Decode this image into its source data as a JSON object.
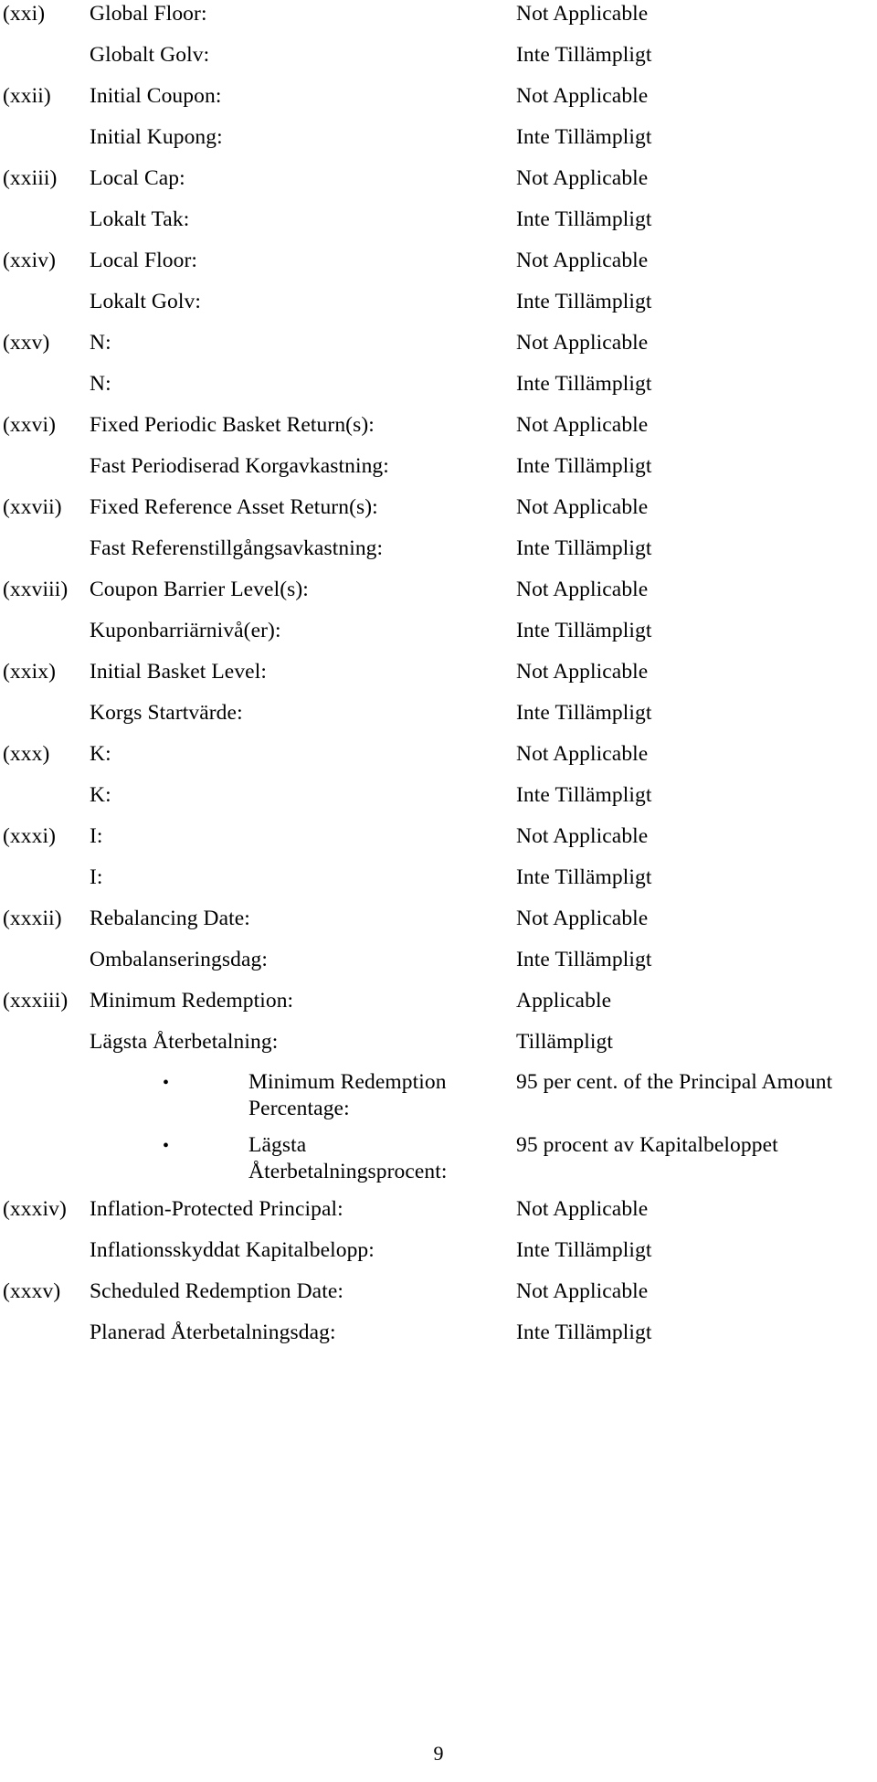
{
  "document": {
    "type": "final-terms-schedule",
    "page_number": "9",
    "languages": [
      "English",
      "Swedish"
    ]
  },
  "rows": [
    {
      "kind": "item",
      "num": "(xxi)",
      "label": "Global Floor:",
      "value": "Not Applicable"
    },
    {
      "kind": "trans",
      "num": "",
      "label": "Globalt Golv:",
      "value": "Inte Tillämpligt"
    },
    {
      "kind": "item",
      "num": "(xxii)",
      "label": "Initial Coupon:",
      "value": "Not Applicable"
    },
    {
      "kind": "trans",
      "num": "",
      "label": "Initial Kupong:",
      "value": "Inte Tillämpligt"
    },
    {
      "kind": "item",
      "num": "(xxiii)",
      "label": "Local Cap:",
      "value": "Not Applicable"
    },
    {
      "kind": "trans",
      "num": "",
      "label": "Lokalt Tak:",
      "value": "Inte Tillämpligt"
    },
    {
      "kind": "item",
      "num": "(xxiv)",
      "label": "Local Floor:",
      "value": "Not Applicable"
    },
    {
      "kind": "trans",
      "num": "",
      "label": "Lokalt Golv:",
      "value": "Inte Tillämpligt"
    },
    {
      "kind": "item",
      "num": "(xxv)",
      "label": "N:",
      "value": "Not Applicable"
    },
    {
      "kind": "trans",
      "num": "",
      "label": "N:",
      "value": "Inte Tillämpligt"
    },
    {
      "kind": "item",
      "num": "(xxvi)",
      "label": "Fixed Periodic Basket Return(s):",
      "value": "Not Applicable"
    },
    {
      "kind": "trans",
      "num": "",
      "label": "Fast Periodiserad Korgavkastning:",
      "value": "Inte Tillämpligt"
    },
    {
      "kind": "item",
      "num": "(xxvii)",
      "label": "Fixed Reference Asset Return(s):",
      "value": "Not Applicable"
    },
    {
      "kind": "trans",
      "num": "",
      "label": "Fast Referenstillgångsavkastning:",
      "value": "Inte Tillämpligt"
    },
    {
      "kind": "item",
      "num": "(xxviii)",
      "label": "Coupon Barrier Level(s):",
      "value": "Not Applicable"
    },
    {
      "kind": "trans",
      "num": "",
      "label": "Kuponbarriärnivå(er):",
      "value": "Inte Tillämpligt"
    },
    {
      "kind": "item",
      "num": "(xxix)",
      "label": "Initial Basket Level:",
      "value": "Not Applicable"
    },
    {
      "kind": "trans",
      "num": "",
      "label": "Korgs Startvärde:",
      "value": "Inte Tillämpligt"
    },
    {
      "kind": "item",
      "num": "(xxx)",
      "label": "K:",
      "value": "Not Applicable"
    },
    {
      "kind": "trans",
      "num": "",
      "label": "K:",
      "value": "Inte Tillämpligt"
    },
    {
      "kind": "item",
      "num": "(xxxi)",
      "label": "I:",
      "value": "Not Applicable"
    },
    {
      "kind": "trans",
      "num": "",
      "label": "I:",
      "value": "Inte Tillämpligt"
    },
    {
      "kind": "item",
      "num": "(xxxii)",
      "label": "Rebalancing Date:",
      "value": "Not Applicable"
    },
    {
      "kind": "trans",
      "num": "",
      "label": "Ombalanseringsdag:",
      "value": "Inte Tillämpligt"
    },
    {
      "kind": "item",
      "num": "(xxxiii)",
      "label": "Minimum Redemption:",
      "value": "Applicable"
    },
    {
      "kind": "trans",
      "num": "",
      "label": "Lägsta Återbetalning:",
      "value": "Tillämpligt"
    },
    {
      "kind": "sub",
      "bullet": "•",
      "label": "Minimum Redemption Percentage:",
      "value": "95 per cent. of the Principal Amount"
    },
    {
      "kind": "sub",
      "bullet": "•",
      "label": "Lägsta Återbetalningsprocent:",
      "value": "95 procent av Kapitalbeloppet"
    },
    {
      "kind": "item",
      "num": "(xxxiv)",
      "label": "Inflation-Protected Principal:",
      "value": "Not Applicable"
    },
    {
      "kind": "trans",
      "num": "",
      "label": "Inflationsskyddat Kapitalbelopp:",
      "value": "Inte Tillämpligt"
    },
    {
      "kind": "item",
      "num": "(xxxv)",
      "label": "Scheduled Redemption Date:",
      "value": "Not Applicable"
    },
    {
      "kind": "trans",
      "num": "",
      "label": "Planerad Återbetalningsdag:",
      "value": "Inte Tillämpligt"
    }
  ]
}
